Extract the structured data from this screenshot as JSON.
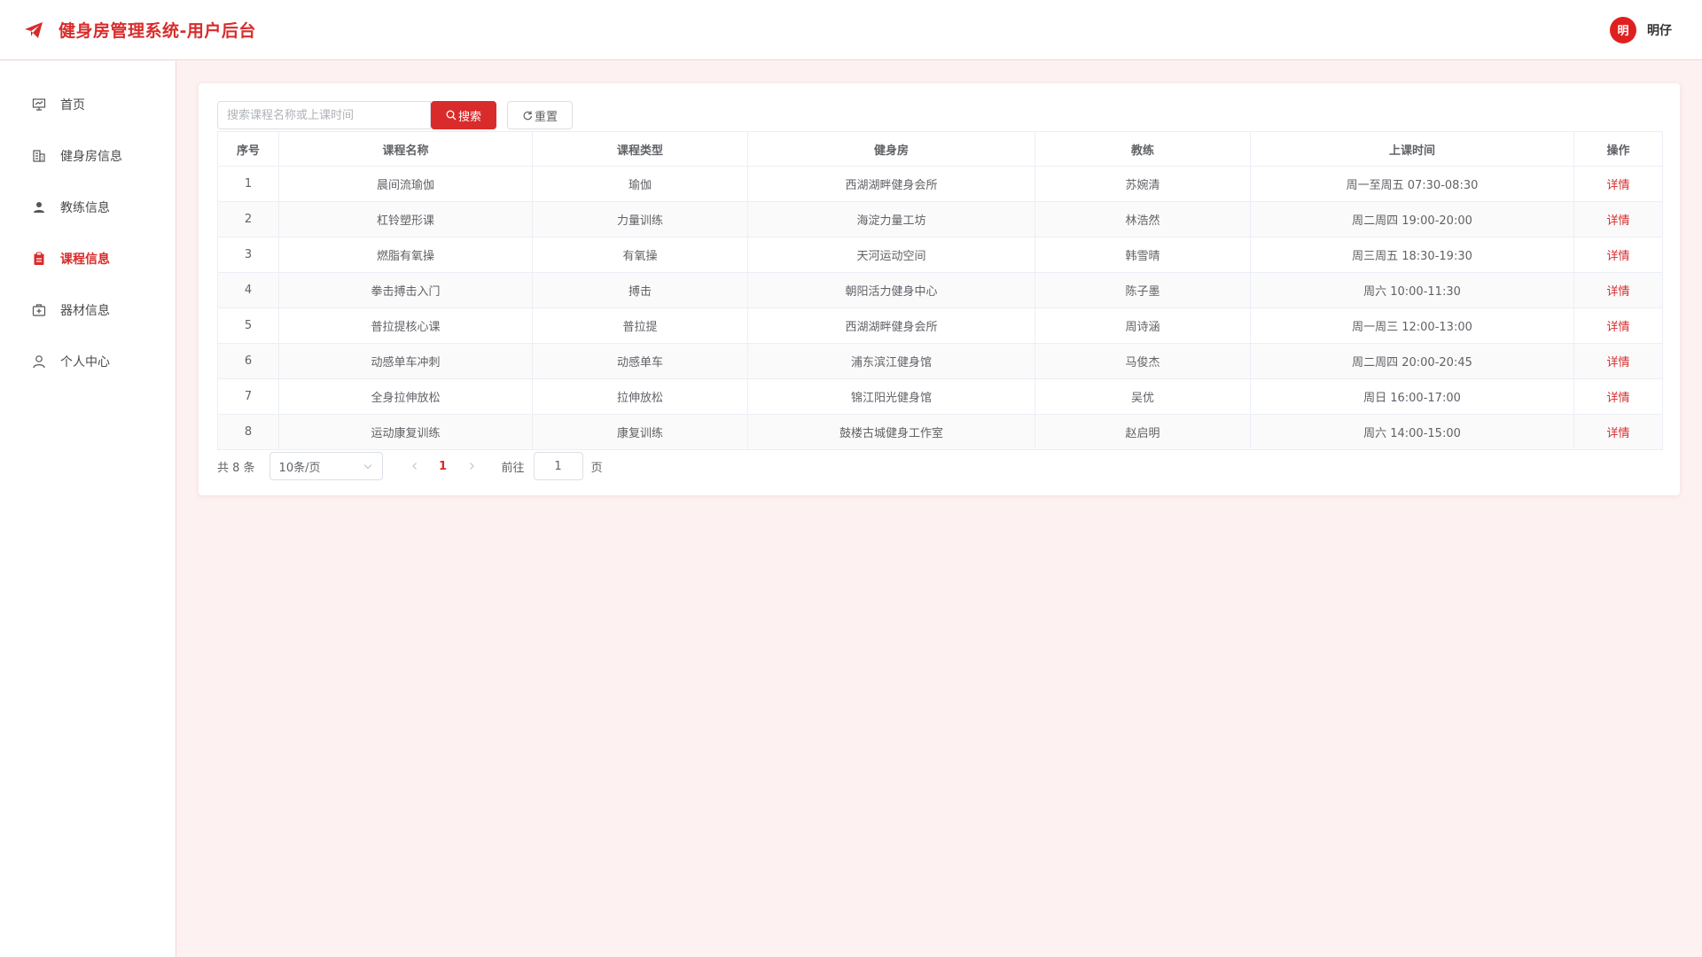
{
  "header": {
    "title": "健身房管理系统-用户后台",
    "user_avatar_text": "明",
    "user_name": "明仔"
  },
  "sidebar": {
    "items": [
      {
        "label": "首页",
        "icon": "presentation-icon",
        "active": false
      },
      {
        "label": "健身房信息",
        "icon": "building-icon",
        "active": false
      },
      {
        "label": "教练信息",
        "icon": "user-icon",
        "active": false
      },
      {
        "label": "课程信息",
        "icon": "clipboard-icon",
        "active": true
      },
      {
        "label": "器材信息",
        "icon": "kit-icon",
        "active": false
      },
      {
        "label": "个人中心",
        "icon": "person-icon",
        "active": false
      }
    ]
  },
  "toolbar": {
    "search_placeholder": "搜索课程名称或上课时间",
    "search_value": "",
    "search_label": "搜索",
    "reset_label": "重置"
  },
  "table": {
    "columns": [
      "序号",
      "课程名称",
      "课程类型",
      "健身房",
      "教练",
      "上课时间",
      "操作"
    ],
    "action_label": "详情",
    "rows": [
      [
        "1",
        "晨间流瑜伽",
        "瑜伽",
        "西湖湖畔健身会所",
        "苏婉清",
        "周一至周五 07:30-08:30"
      ],
      [
        "2",
        "杠铃塑形课",
        "力量训练",
        "海淀力量工坊",
        "林浩然",
        "周二周四 19:00-20:00"
      ],
      [
        "3",
        "燃脂有氧操",
        "有氧操",
        "天河运动空间",
        "韩雪晴",
        "周三周五 18:30-19:30"
      ],
      [
        "4",
        "拳击搏击入门",
        "搏击",
        "朝阳活力健身中心",
        "陈子墨",
        "周六 10:00-11:30"
      ],
      [
        "5",
        "普拉提核心课",
        "普拉提",
        "西湖湖畔健身会所",
        "周诗涵",
        "周一周三 12:00-13:00"
      ],
      [
        "6",
        "动感单车冲刺",
        "动感单车",
        "浦东滨江健身馆",
        "马俊杰",
        "周二周四 20:00-20:45"
      ],
      [
        "7",
        "全身拉伸放松",
        "拉伸放松",
        "锦江阳光健身馆",
        "吴优",
        "周日 16:00-17:00"
      ],
      [
        "8",
        "运动康复训练",
        "康复训练",
        "鼓楼古城健身工作室",
        "赵启明",
        "周六 14:00-15:00"
      ]
    ]
  },
  "pagination": {
    "total_text": "共 8 条",
    "page_size": "10条/页",
    "current_page": "1",
    "goto_label": "前往",
    "goto_value": "1",
    "goto_suffix": "页"
  },
  "colors": {
    "accent": "#d92b2b",
    "background": "#fdf1f1"
  }
}
